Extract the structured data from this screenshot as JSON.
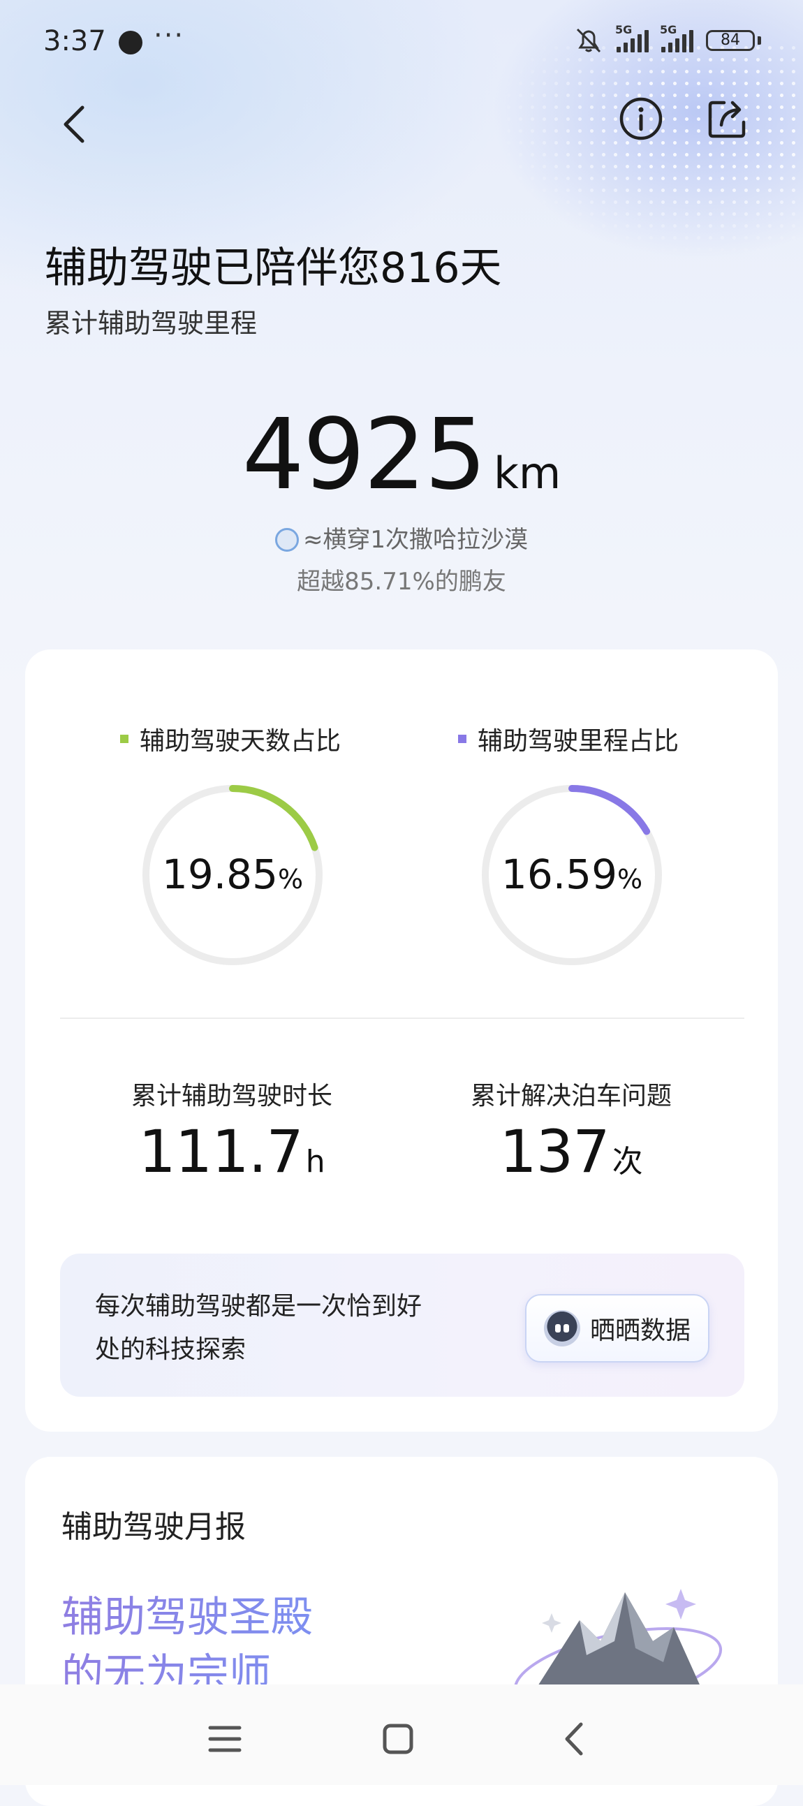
{
  "status_bar": {
    "time": "3:37",
    "more": "···",
    "sim1": "5G",
    "sim2": "5G",
    "battery": "84"
  },
  "header": {
    "title": "辅助驾驶已陪伴您816天",
    "subtitle": "累计辅助驾驶里程"
  },
  "mileage": {
    "value": "4925",
    "unit": "km",
    "equivalent": "≈横穿1次撒哈拉沙漠",
    "rank": "超越85.71%的鹏友"
  },
  "ratios": [
    {
      "label": "辅助驾驶天数占比",
      "value": "19.85",
      "unit": "%",
      "fraction": 0.1985,
      "color": "#9ccb46"
    },
    {
      "label": "辅助驾驶里程占比",
      "value": "16.59",
      "unit": "%",
      "fraction": 0.1659,
      "color": "#8878e6"
    }
  ],
  "stats": [
    {
      "label": "累计辅助驾驶时长",
      "value": "111.7",
      "unit": "h"
    },
    {
      "label": "累计解决泊车问题",
      "value": "137",
      "unit": "次"
    }
  ],
  "promo": {
    "line1": "每次辅助驾驶都是一次恰到好",
    "line2": "处的科技探索",
    "button_label": "晒晒数据"
  },
  "monthly_report": {
    "title": "辅助驾驶月报",
    "headline_line1": "辅助驾驶圣殿",
    "headline_line2": "的无为宗师"
  },
  "colors": {
    "ring_track": "#ececec",
    "accent_purple": "#8878e6",
    "accent_green": "#9ccb46"
  }
}
